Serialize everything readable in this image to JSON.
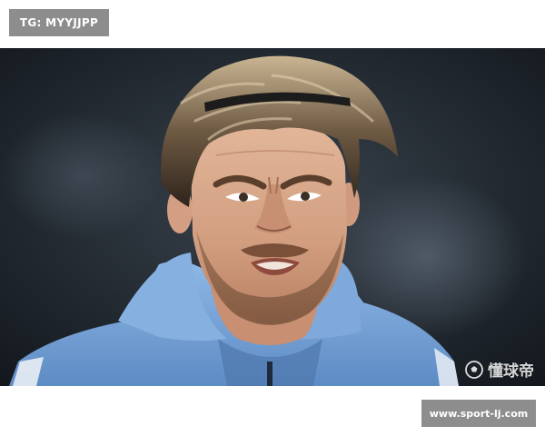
{
  "top_tag": {
    "text": "TG: MYYJJPP"
  },
  "watermark": {
    "text": "懂球帝",
    "icon": "football-icon"
  },
  "bottom_tag": {
    "text": "www.sport-lj.com"
  },
  "colors": {
    "tag_background": "#8d8d8d",
    "tag_text": "#ffffff",
    "jacket": "#7aa7dc",
    "background": "#1b2128"
  }
}
